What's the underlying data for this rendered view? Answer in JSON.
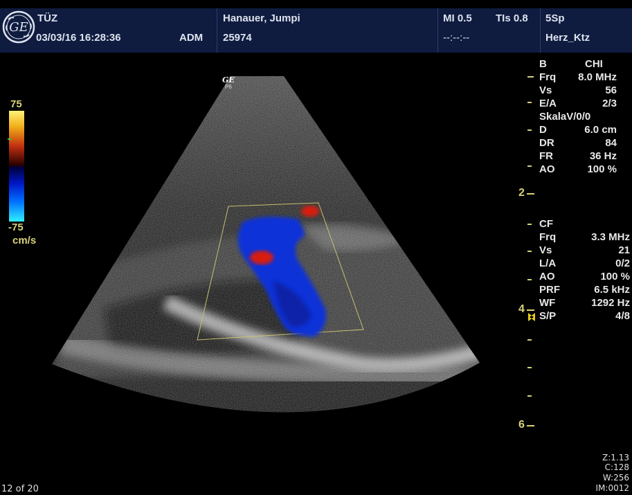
{
  "header": {
    "institution": "TÜZ",
    "datetime": "03/03/16 16:28:36",
    "operator": "ADM",
    "patient_name": "Hanauer, Jumpi",
    "patient_id": "25974",
    "mi": "MI 0.5",
    "tis": "TIs 0.8",
    "probe": "5Sp",
    "time_placeholder": "--:--:--",
    "preset": "Herz_Ktz"
  },
  "probe_label": {
    "brand": "GE",
    "model": "P6"
  },
  "color_scale": {
    "max": "75",
    "min": "-75",
    "unit": "cm/s"
  },
  "b_mode": {
    "title": "B",
    "mode": "CHI",
    "params": [
      {
        "label": "Frq",
        "value": "8.0 MHz"
      },
      {
        "label": "Vs",
        "value": "56"
      },
      {
        "label": "E/A",
        "value": "2/3"
      },
      {
        "label": "SkalaV/0/0",
        "value": ""
      },
      {
        "label": "D",
        "value": "6.0 cm"
      },
      {
        "label": "DR",
        "value": "84"
      },
      {
        "label": "FR",
        "value": "36 Hz"
      },
      {
        "label": "AO",
        "value": "100 %"
      }
    ]
  },
  "cf_mode": {
    "title": "CF",
    "params": [
      {
        "label": "Frq",
        "value": "3.3 MHz"
      },
      {
        "label": "Vs",
        "value": "21"
      },
      {
        "label": "L/A",
        "value": "0/2"
      },
      {
        "label": "AO",
        "value": "100 %"
      },
      {
        "label": "PRF",
        "value": "6.5 kHz"
      },
      {
        "label": "WF",
        "value": "1292 Hz"
      },
      {
        "label": "S/P",
        "value": "4/8"
      }
    ]
  },
  "depth_marks": {
    "d2": "2",
    "d4": "4",
    "d6": "6"
  },
  "image_info": {
    "zoom": "Z:1.13",
    "contrast": "C:128",
    "window": "W:256",
    "image_number": "IM:0012"
  },
  "frame_counter": "12 of 20",
  "colors": {
    "header_bg": "#0f1b3f",
    "depth_marker": "#d8d27a",
    "doppler_blue": "#1030d8",
    "doppler_red": "#d81a08"
  }
}
